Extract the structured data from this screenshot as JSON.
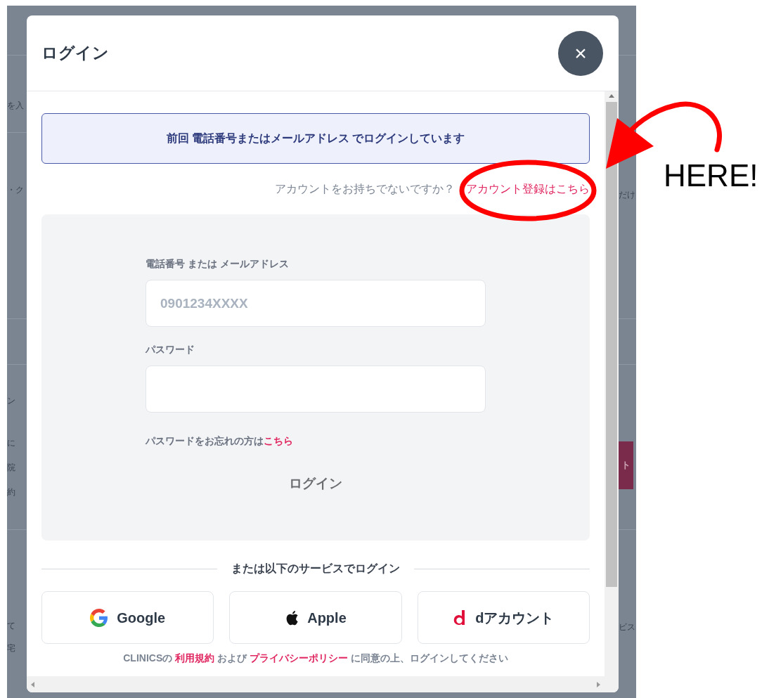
{
  "background_page": {
    "left_fragments": [
      {
        "text": "を入",
        "kind": "text"
      },
      {
        "text": "・ク",
        "kind": "text"
      },
      {
        "text": "ン",
        "kind": "text"
      },
      {
        "text": "に",
        "kind": "text"
      },
      {
        "text": "院",
        "kind": "text"
      },
      {
        "text": "約",
        "kind": "text"
      },
      {
        "text": "て",
        "kind": "text"
      },
      {
        "text": "宅",
        "kind": "text"
      }
    ],
    "right_fragments": [
      {
        "text": "だけ",
        "kind": "text"
      },
      {
        "text": "ト",
        "kind": "button"
      },
      {
        "text": "ビス",
        "kind": "text"
      }
    ]
  },
  "dialog": {
    "title": "ログイン",
    "close_label": "×",
    "notice": "前回 電話番号またはメールアドレス でログインしています",
    "signup_prompt": "アカウントをお持ちでないですか？",
    "signup_link": "アカウント登録はこちら",
    "form": {
      "fields": [
        {
          "label": "電話番号 または メールアドレス",
          "placeholder": "0901234XXXX"
        },
        {
          "label": "パスワード"
        }
      ],
      "forgot_text": "パスワードをお忘れの方は",
      "forgot_link": "こちら",
      "submit": {
        "label": "ログイン",
        "disabled": true
      }
    },
    "divider": "または以下のサービスでログイン",
    "providers": [
      {
        "kind": "google",
        "label": "Google"
      },
      {
        "kind": "apple",
        "label": "Apple"
      },
      {
        "kind": "docomo",
        "label": "dアカウント"
      }
    ],
    "terms": [
      {
        "text": "CLINICSの",
        "link": false
      },
      {
        "text": "利用規約",
        "link": true
      },
      {
        "text": "および",
        "link": false
      },
      {
        "text": "プライバシーポリシー",
        "link": true
      },
      {
        "text": "に同意の上、ログインしてください",
        "link": false
      }
    ]
  },
  "annotation": {
    "text": "HERE!"
  }
}
